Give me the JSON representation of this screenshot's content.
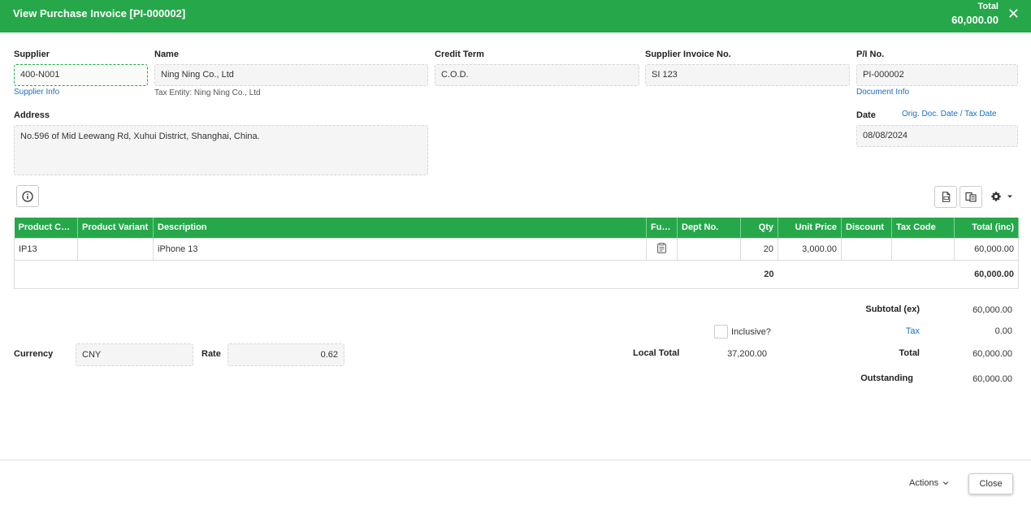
{
  "header": {
    "title": "View Purchase Invoice [PI-000002]",
    "total_label": "Total",
    "total_value": "60,000.00",
    "close_glyph": "✕"
  },
  "form": {
    "supplier_label": "Supplier",
    "supplier_value": "400-N001",
    "supplier_info_link": "Supplier Info",
    "name_label": "Name",
    "name_value": "Ning Ning Co., Ltd",
    "tax_entity": "Tax Entity: Ning Ning Co., Ltd",
    "credit_term_label": "Credit Term",
    "credit_term_value": "C.O.D.",
    "supplier_invoice_label": "Supplier Invoice No.",
    "supplier_invoice_value": "SI 123",
    "pi_no_label": "P/I No.",
    "pi_no_value": "PI-000002",
    "document_info_link": "Document Info",
    "address_label": "Address",
    "address_value": "No.596 of Mid Leewang Rd, Xuhui District, Shanghai, China.",
    "date_label": "Date",
    "orig_date_link": "Orig. Doc. Date / Tax Date",
    "date_value": "08/08/2024"
  },
  "toolbar": {
    "info_icon": "info-icon",
    "pdf_icon": "pdf-icon",
    "copy_icon": "copy-icon",
    "gear_icon": "gear-icon"
  },
  "grid": {
    "columns": [
      "Product Code",
      "Product Variant",
      "Description",
      "Furt...",
      "Dept No.",
      "Qty",
      "Unit Price",
      "Discount",
      "Tax Code",
      "Total (inc)"
    ],
    "rows": [
      {
        "product_code": "IP13",
        "product_variant": "",
        "description": "iPhone 13",
        "dept_no": "",
        "qty": "20",
        "unit_price": "3,000.00",
        "discount": "",
        "tax_code": "",
        "total": "60,000.00"
      }
    ],
    "totals": {
      "qty": "20",
      "total": "60,000.00"
    }
  },
  "summary": {
    "subtotal_label": "Subtotal (ex)",
    "subtotal_value": "60,000.00",
    "inclusive_label": "Inclusive?",
    "tax_label": "Tax",
    "tax_value": "0.00",
    "total_label": "Total",
    "total_value": "60,000.00",
    "outstanding_label": "Outstanding",
    "outstanding_value": "60,000.00",
    "local_total_label": "Local Total",
    "local_total_value": "37,200.00",
    "currency_label": "Currency",
    "currency_value": "CNY",
    "rate_label": "Rate",
    "rate_value": "0.62"
  },
  "footer": {
    "actions_label": "Actions",
    "close_label": "Close"
  },
  "colors": {
    "accent": "#26a84a",
    "link": "#1a6fc4"
  }
}
